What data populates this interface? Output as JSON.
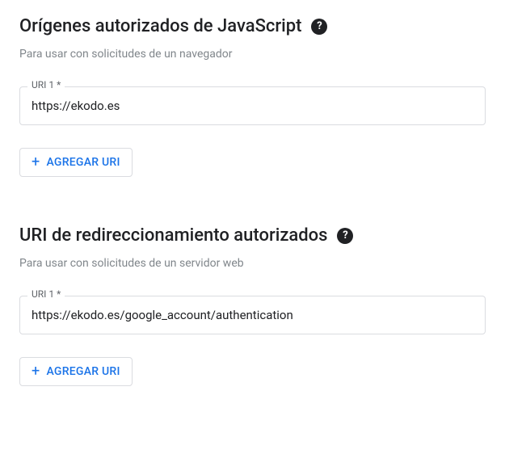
{
  "sections": {
    "js_origins": {
      "title": "Orígenes autorizados de JavaScript",
      "description": "Para usar con solicitudes de un navegador",
      "field_label": "URI 1 *",
      "field_value": "https://ekodo.es",
      "add_button_label": "AGREGAR URI"
    },
    "redirect_uris": {
      "title": "URI de redireccionamiento autorizados",
      "description": "Para usar con solicitudes de un servidor web",
      "field_label": "URI 1 *",
      "field_value": "https://ekodo.es/google_account/authentication",
      "add_button_label": "AGREGAR URI"
    }
  },
  "icons": {
    "help": "?",
    "plus": "+"
  }
}
